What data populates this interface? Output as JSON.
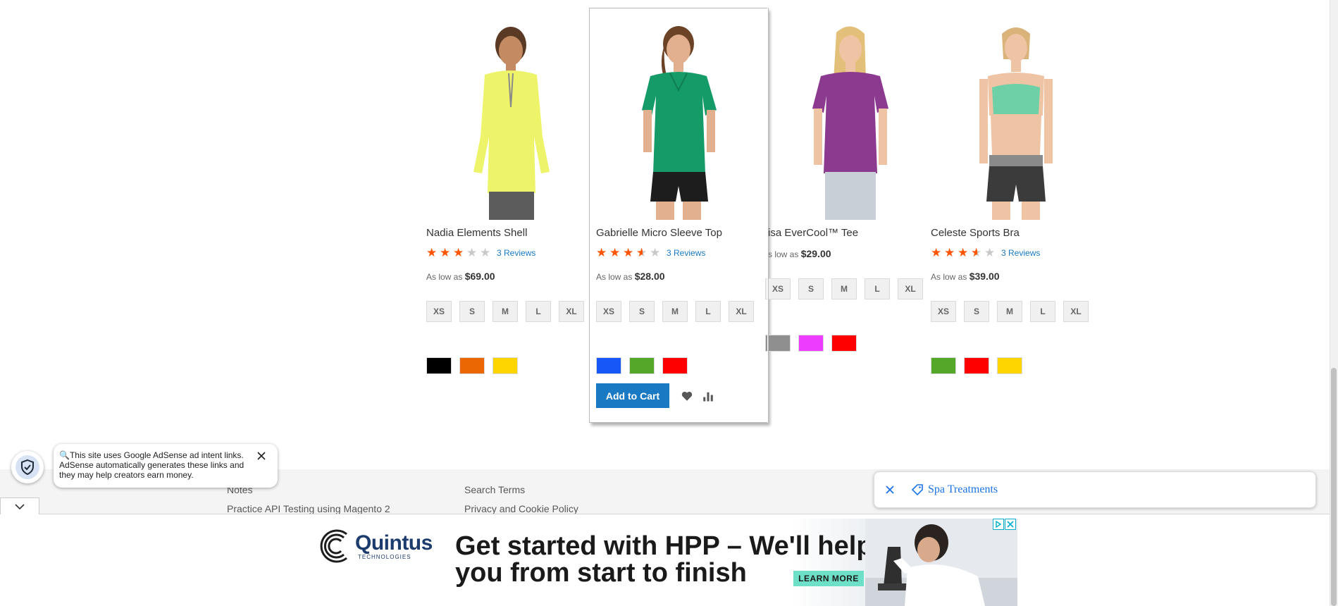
{
  "products": [
    {
      "name": "Nadia Elements Shell",
      "rating_stars": 3.0,
      "reviews_label": "3 Reviews",
      "price_prefix": "As low as",
      "price": "$69.00",
      "sizes": [
        "XS",
        "S",
        "M",
        "L",
        "XL"
      ],
      "colors": [
        "#000000",
        "#eb6703",
        "#ffd500"
      ]
    },
    {
      "name": "Gabrielle Micro Sleeve Top",
      "rating_stars": 3.5,
      "reviews_label": "3 Reviews",
      "price_prefix": "As low as",
      "price": "$28.00",
      "sizes": [
        "XS",
        "S",
        "M",
        "L",
        "XL"
      ],
      "colors": [
        "#1857f7",
        "#53a828",
        "#ff0000"
      ],
      "add_to_cart": "Add to Cart",
      "hovered": true
    },
    {
      "name": "Elisa EverCool™ Tee",
      "name_visible": "isa EverCool™ Tee",
      "rating_stars": null,
      "price_prefix": "s low as",
      "price": "$29.00",
      "sizes": [
        "XS",
        "S",
        "M",
        "L",
        "XL"
      ],
      "colors": [
        "#8f8f8f",
        "#ef3dff",
        "#ff0000"
      ]
    },
    {
      "name": "Celeste Sports Bra",
      "rating_stars": 3.5,
      "reviews_label": "3 Reviews",
      "price_prefix": "As low as",
      "price": "$39.00",
      "sizes": [
        "XS",
        "S",
        "M",
        "L",
        "XL"
      ],
      "colors": [
        "#53a828",
        "#ff0000",
        "#ffd500"
      ]
    }
  ],
  "footer": {
    "links": [
      "Notes",
      "Practice API Testing using Magento 2",
      "Search Terms",
      "Privacy and Cookie Policy"
    ]
  },
  "ad_notice": {
    "text": "🔍This site uses Google AdSense ad intent links. AdSense automatically generates these links and they may help creators earn money."
  },
  "spa_bar": {
    "label": "Spa Treatments"
  },
  "ad_banner": {
    "brand": "Quintus",
    "brand_sub": "TECHNOLOGIES",
    "headline_line1": "Get started with HPP – We'll help",
    "headline_line2": "you from start to finish",
    "cta": "LEARN MORE"
  },
  "colors": {
    "link": "#1979c3",
    "star": "#ff5501",
    "button": "#1979c3",
    "spa_link": "#1a73e8"
  }
}
